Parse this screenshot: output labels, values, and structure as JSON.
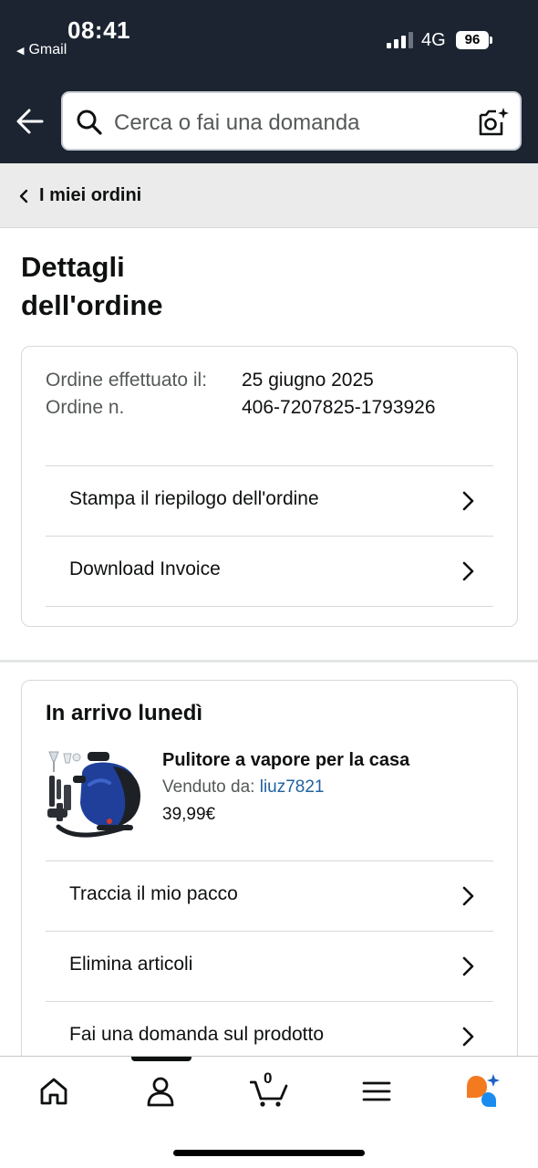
{
  "status_bar": {
    "time": "08:41",
    "back_app": "Gmail",
    "network": "4G",
    "battery": "96"
  },
  "search": {
    "placeholder": "Cerca o fai una domanda"
  },
  "breadcrumb": {
    "label": "I miei ordini"
  },
  "page": {
    "title_line1": "Dettagli",
    "title_line2": "dell'ordine"
  },
  "order_summary": {
    "date_label": "Ordine effettuato il:",
    "date_value": "25 giugno 2025",
    "number_label": "Ordine n.",
    "number_value": "406-7207825-1793926",
    "actions": [
      {
        "label": "Stampa il riepilogo dell'ordine"
      },
      {
        "label": "Download Invoice"
      }
    ]
  },
  "shipment": {
    "heading": "In arrivo lunedì",
    "product": {
      "name": "Pulitore a vapore per la casa",
      "sold_by_label": "Venduto da:",
      "seller": "liuz7821",
      "price": "39,99€"
    },
    "actions": [
      {
        "label": "Traccia il mio pacco"
      },
      {
        "label": "Elimina articoli"
      },
      {
        "label": "Fai una domanda sul prodotto"
      }
    ]
  },
  "bottom_nav": {
    "items": [
      {
        "icon": "home-icon"
      },
      {
        "icon": "account-icon"
      },
      {
        "icon": "cart-icon"
      },
      {
        "icon": "menu-icon"
      },
      {
        "icon": "rufus-icon"
      }
    ],
    "cart_count": "0"
  },
  "colors": {
    "header_bg": "#1c2431",
    "link": "#2162a1",
    "text": "#0f1111",
    "muted": "#565959"
  }
}
